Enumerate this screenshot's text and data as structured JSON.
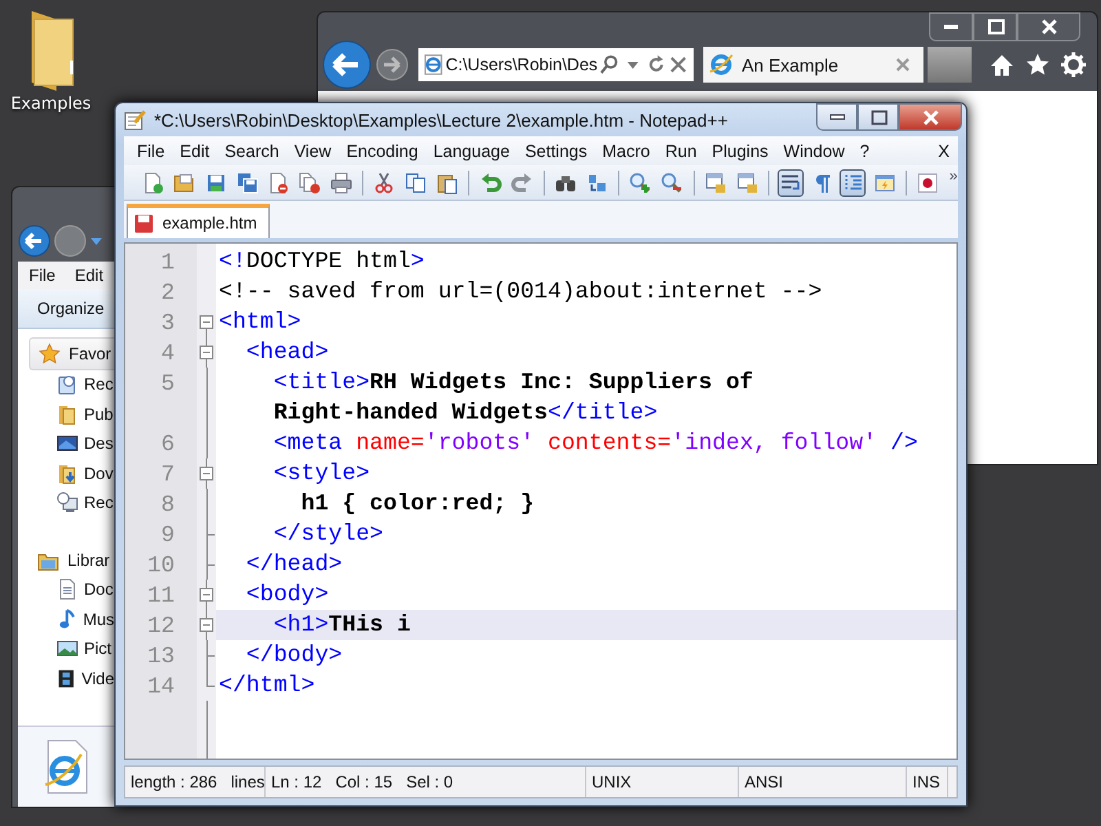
{
  "desktop": {
    "icons": [
      {
        "label": "Examples"
      }
    ]
  },
  "browser": {
    "address": "C:\\Users\\Robin\\Des",
    "tabs": [
      {
        "title": "An Example",
        "selected": true
      }
    ]
  },
  "explorer": {
    "menu": [
      "File",
      "Edit"
    ],
    "toolbar": [
      "Organize"
    ],
    "nav": [
      {
        "kind": "header",
        "label": "Favor"
      },
      {
        "kind": "item",
        "label": "Rec"
      },
      {
        "kind": "item",
        "label": "Pub"
      },
      {
        "kind": "item",
        "label": "Des"
      },
      {
        "kind": "item",
        "label": "Dov"
      },
      {
        "kind": "item",
        "label": "Rec"
      },
      {
        "kind": "header",
        "label": "Librar"
      },
      {
        "kind": "item",
        "label": "Doc"
      },
      {
        "kind": "item",
        "label": "Mus"
      },
      {
        "kind": "item",
        "label": "Pict"
      },
      {
        "kind": "item",
        "label": "Vide"
      }
    ]
  },
  "notepad": {
    "title": "*C:\\Users\\Robin\\Desktop\\Examples\\Lecture 2\\example.htm - Notepad++",
    "menu": [
      "File",
      "Edit",
      "Search",
      "View",
      "Encoding",
      "Language",
      "Settings",
      "Macro",
      "Run",
      "Plugins",
      "Window",
      "?"
    ],
    "menu_close": "X",
    "toolbar": [
      {
        "kind": "button",
        "pressed": false
      },
      {
        "kind": "button",
        "pressed": false
      },
      {
        "kind": "button",
        "pressed": false
      },
      {
        "kind": "button",
        "pressed": false
      },
      {
        "kind": "button",
        "pressed": false
      },
      {
        "kind": "button",
        "pressed": false
      },
      {
        "kind": "button",
        "pressed": false
      },
      {
        "kind": "separator"
      },
      {
        "kind": "button",
        "pressed": false
      },
      {
        "kind": "button",
        "pressed": false
      },
      {
        "kind": "button",
        "pressed": false
      },
      {
        "kind": "separator"
      },
      {
        "kind": "button",
        "pressed": false
      },
      {
        "kind": "button",
        "pressed": false
      },
      {
        "kind": "separator"
      },
      {
        "kind": "button",
        "pressed": false
      },
      {
        "kind": "button",
        "pressed": false
      },
      {
        "kind": "separator"
      },
      {
        "kind": "button",
        "pressed": false
      },
      {
        "kind": "button",
        "pressed": false
      },
      {
        "kind": "separator"
      },
      {
        "kind": "button",
        "pressed": false
      },
      {
        "kind": "button",
        "pressed": false
      },
      {
        "kind": "separator"
      },
      {
        "kind": "button",
        "pressed": true
      },
      {
        "kind": "button",
        "pressed": false
      },
      {
        "kind": "button",
        "pressed": true
      },
      {
        "kind": "button",
        "pressed": false
      },
      {
        "kind": "separator"
      },
      {
        "kind": "button",
        "pressed": false
      }
    ],
    "toolbar_overflow": "»",
    "tabs": [
      {
        "label": "example.htm",
        "selected": true
      }
    ],
    "lines": [
      {
        "number": "1",
        "current": false,
        "rows": [
          [
            {
              "kind": "tag",
              "text": "<!"
            },
            {
              "kind": "plain",
              "text": "DOCTYPE html"
            },
            {
              "kind": "tag",
              "text": ">"
            }
          ]
        ]
      },
      {
        "number": "2",
        "current": false,
        "rows": [
          [
            {
              "kind": "plain",
              "text": "<!-- saved from url=(0014)about:internet -->"
            }
          ]
        ]
      },
      {
        "number": "3",
        "current": false,
        "rows": [
          [
            {
              "kind": "tag",
              "text": "<html>"
            }
          ]
        ]
      },
      {
        "number": "4",
        "current": false,
        "rows": [
          [
            {
              "kind": "tag",
              "text": "  <head>"
            }
          ]
        ]
      },
      {
        "number": "5",
        "current": false,
        "rows": [
          [
            {
              "kind": "tag",
              "text": "    <title>"
            },
            {
              "kind": "text",
              "text": "RH Widgets Inc: Suppliers of"
            }
          ],
          [
            {
              "kind": "text",
              "text": "    Right-handed Widgets"
            },
            {
              "kind": "tag",
              "text": "</title>"
            }
          ]
        ]
      },
      {
        "number": "6",
        "current": false,
        "rows": [
          [
            {
              "kind": "tag",
              "text": "    <meta "
            },
            {
              "kind": "attr",
              "text": "name="
            },
            {
              "kind": "value",
              "text": "'robots'"
            },
            {
              "kind": "attr",
              "text": " contents="
            },
            {
              "kind": "value",
              "text": "'index, follow'"
            },
            {
              "kind": "tag",
              "text": " />"
            }
          ]
        ]
      },
      {
        "number": "7",
        "current": false,
        "rows": [
          [
            {
              "kind": "tag",
              "text": "    <style>"
            }
          ]
        ]
      },
      {
        "number": "8",
        "current": false,
        "rows": [
          [
            {
              "kind": "text",
              "text": "      h1 { color:red; }"
            }
          ]
        ]
      },
      {
        "number": "9",
        "current": false,
        "rows": [
          [
            {
              "kind": "tag",
              "text": "    </style>"
            }
          ]
        ]
      },
      {
        "number": "10",
        "current": false,
        "rows": [
          [
            {
              "kind": "tag",
              "text": "  </head>"
            }
          ]
        ]
      },
      {
        "number": "11",
        "current": false,
        "rows": [
          [
            {
              "kind": "tag",
              "text": "  <body>"
            }
          ]
        ]
      },
      {
        "number": "12",
        "current": true,
        "rows": [
          [
            {
              "kind": "tag",
              "text": "    <h1>"
            },
            {
              "kind": "text",
              "text": "THis i"
            }
          ]
        ]
      },
      {
        "number": "13",
        "current": false,
        "rows": [
          [
            {
              "kind": "tag",
              "text": "  </body>"
            }
          ]
        ]
      },
      {
        "number": "14",
        "current": false,
        "rows": [
          [
            {
              "kind": "tag",
              "text": "</html>"
            }
          ]
        ]
      }
    ],
    "status": [
      {
        "texts": [
          "length : 286",
          "lines"
        ]
      },
      {
        "texts": [
          "Ln : 12",
          "Col : 15",
          "Sel : 0"
        ]
      },
      {
        "texts": [
          "UNIX"
        ]
      },
      {
        "texts": [
          "ANSI"
        ]
      },
      {
        "texts": [
          "INS"
        ]
      }
    ]
  }
}
